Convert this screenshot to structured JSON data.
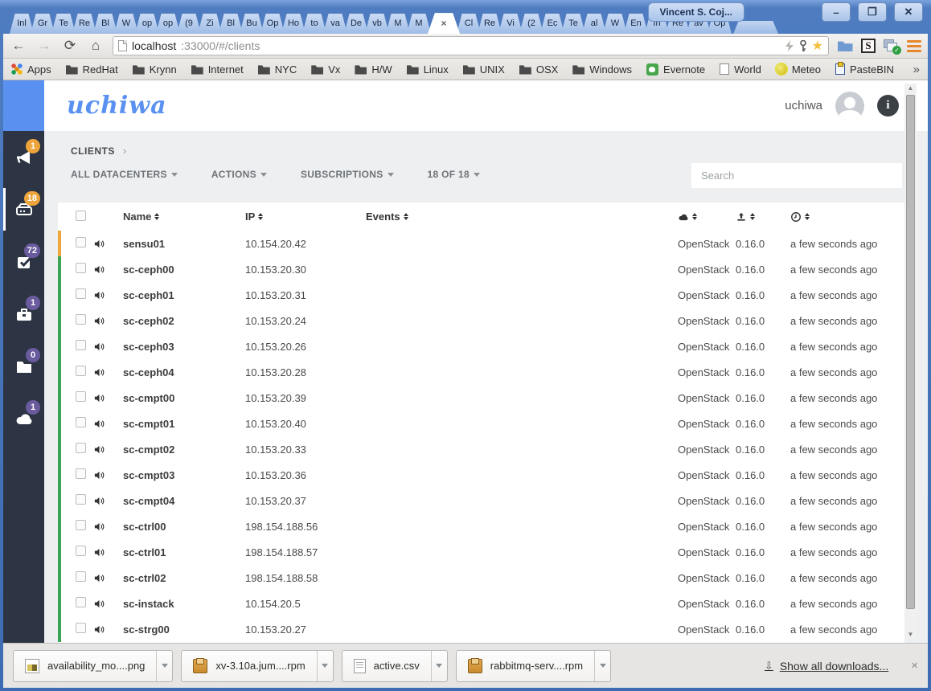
{
  "window": {
    "title": "Vincent S. Coj...",
    "minimize": "–",
    "maximize": "❐",
    "close": "✕"
  },
  "tabs": {
    "before_active": [
      "Inl",
      "Gr",
      "Te",
      "Re",
      "Bl",
      "W",
      "op",
      "op",
      "(9",
      "Zi",
      "Bl",
      "Bu",
      "Op",
      "Ho",
      "to",
      "va",
      "De",
      "vb",
      "M",
      "M"
    ],
    "active_close": "×",
    "after_active": [
      "Cl",
      "Re",
      "Vi",
      "(2",
      "Ec",
      "Te",
      "al",
      "W",
      "En",
      "In",
      "Re",
      "av",
      "Op"
    ]
  },
  "toolbar": {
    "back": "←",
    "forward": "→",
    "reload": "⟳",
    "home": "⌂",
    "url_host": "localhost",
    "url_rest": ":33000/#/clients",
    "star": "★",
    "ext_s_label": "S",
    "winchk_check": "✓"
  },
  "bookmarks_bar": {
    "items": [
      {
        "label": "Apps",
        "icon": "apps-grid"
      },
      {
        "label": "RedHat",
        "icon": "folder"
      },
      {
        "label": "Krynn",
        "icon": "folder"
      },
      {
        "label": "Internet",
        "icon": "folder"
      },
      {
        "label": "NYC",
        "icon": "folder"
      },
      {
        "label": "Vx",
        "icon": "folder"
      },
      {
        "label": "H/W",
        "icon": "folder"
      },
      {
        "label": "Linux",
        "icon": "folder"
      },
      {
        "label": "UNIX",
        "icon": "folder"
      },
      {
        "label": "OSX",
        "icon": "folder"
      },
      {
        "label": "Windows",
        "icon": "folder"
      },
      {
        "label": "Evernote",
        "icon": "evernote"
      },
      {
        "label": "World",
        "icon": "page"
      },
      {
        "label": "Meteo",
        "icon": "meteo"
      },
      {
        "label": "PasteBIN",
        "icon": "pastebin"
      }
    ],
    "overflow": "»"
  },
  "app": {
    "logo": "uchiwa",
    "header": {
      "username": "uchiwa",
      "info_label": "i"
    },
    "sidebar": {
      "items": [
        {
          "name": "events",
          "badge": "1"
        },
        {
          "name": "clients",
          "badge": "18",
          "active": true
        },
        {
          "name": "checks",
          "badge": "72"
        },
        {
          "name": "aggregates",
          "badge": "1"
        },
        {
          "name": "stashes",
          "badge": "0"
        },
        {
          "name": "datacenters",
          "badge": "1"
        }
      ]
    },
    "breadcrumb": {
      "current": "CLIENTS",
      "separator": "›"
    },
    "filters": {
      "datacenters": "ALL DATACENTERS",
      "actions": "ACTIONS",
      "subscriptions": "SUBSCRIPTIONS",
      "count": "18 OF 18"
    },
    "search": {
      "placeholder": "Search"
    },
    "table": {
      "columns": {
        "name": "Name",
        "ip": "IP",
        "events": "Events"
      },
      "rows": [
        {
          "name": "sensu01",
          "ip": "10.154.20.42",
          "datacenter": "OpenStack",
          "version": "0.16.0",
          "last_seen": "a few seconds ago",
          "status": "warning"
        },
        {
          "name": "sc-ceph00",
          "ip": "10.153.20.30",
          "datacenter": "OpenStack",
          "version": "0.16.0",
          "last_seen": "a few seconds ago",
          "status": "ok"
        },
        {
          "name": "sc-ceph01",
          "ip": "10.153.20.31",
          "datacenter": "OpenStack",
          "version": "0.16.0",
          "last_seen": "a few seconds ago",
          "status": "ok"
        },
        {
          "name": "sc-ceph02",
          "ip": "10.153.20.24",
          "datacenter": "OpenStack",
          "version": "0.16.0",
          "last_seen": "a few seconds ago",
          "status": "ok"
        },
        {
          "name": "sc-ceph03",
          "ip": "10.153.20.26",
          "datacenter": "OpenStack",
          "version": "0.16.0",
          "last_seen": "a few seconds ago",
          "status": "ok"
        },
        {
          "name": "sc-ceph04",
          "ip": "10.153.20.28",
          "datacenter": "OpenStack",
          "version": "0.16.0",
          "last_seen": "a few seconds ago",
          "status": "ok"
        },
        {
          "name": "sc-cmpt00",
          "ip": "10.153.20.39",
          "datacenter": "OpenStack",
          "version": "0.16.0",
          "last_seen": "a few seconds ago",
          "status": "ok"
        },
        {
          "name": "sc-cmpt01",
          "ip": "10.153.20.40",
          "datacenter": "OpenStack",
          "version": "0.16.0",
          "last_seen": "a few seconds ago",
          "status": "ok"
        },
        {
          "name": "sc-cmpt02",
          "ip": "10.153.20.33",
          "datacenter": "OpenStack",
          "version": "0.16.0",
          "last_seen": "a few seconds ago",
          "status": "ok"
        },
        {
          "name": "sc-cmpt03",
          "ip": "10.153.20.36",
          "datacenter": "OpenStack",
          "version": "0.16.0",
          "last_seen": "a few seconds ago",
          "status": "ok"
        },
        {
          "name": "sc-cmpt04",
          "ip": "10.153.20.37",
          "datacenter": "OpenStack",
          "version": "0.16.0",
          "last_seen": "a few seconds ago",
          "status": "ok"
        },
        {
          "name": "sc-ctrl00",
          "ip": "198.154.188.56",
          "datacenter": "OpenStack",
          "version": "0.16.0",
          "last_seen": "a few seconds ago",
          "status": "ok"
        },
        {
          "name": "sc-ctrl01",
          "ip": "198.154.188.57",
          "datacenter": "OpenStack",
          "version": "0.16.0",
          "last_seen": "a few seconds ago",
          "status": "ok"
        },
        {
          "name": "sc-ctrl02",
          "ip": "198.154.188.58",
          "datacenter": "OpenStack",
          "version": "0.16.0",
          "last_seen": "a few seconds ago",
          "status": "ok"
        },
        {
          "name": "sc-instack",
          "ip": "10.154.20.5",
          "datacenter": "OpenStack",
          "version": "0.16.0",
          "last_seen": "a few seconds ago",
          "status": "ok"
        },
        {
          "name": "sc-strg00",
          "ip": "10.153.20.27",
          "datacenter": "OpenStack",
          "version": "0.16.0",
          "last_seen": "a few seconds ago",
          "status": "ok"
        }
      ]
    },
    "colors": {
      "status_warning": "#F0A63A",
      "status_ok": "#3AA655",
      "accent": "#5A91F0",
      "sidebar_bg": "#2D3544",
      "badge_orange": "#EDA43B",
      "badge_purple": "#6A5A9E"
    }
  },
  "downloads_bar": {
    "items": [
      {
        "label": "availability_mo....png",
        "icon": "image"
      },
      {
        "label": "xv-3.10a.jum....rpm",
        "icon": "package"
      },
      {
        "label": "active.csv",
        "icon": "document"
      },
      {
        "label": "rabbitmq-serv....rpm",
        "icon": "package"
      }
    ],
    "show_all": "Show all downloads...",
    "close": "×"
  }
}
